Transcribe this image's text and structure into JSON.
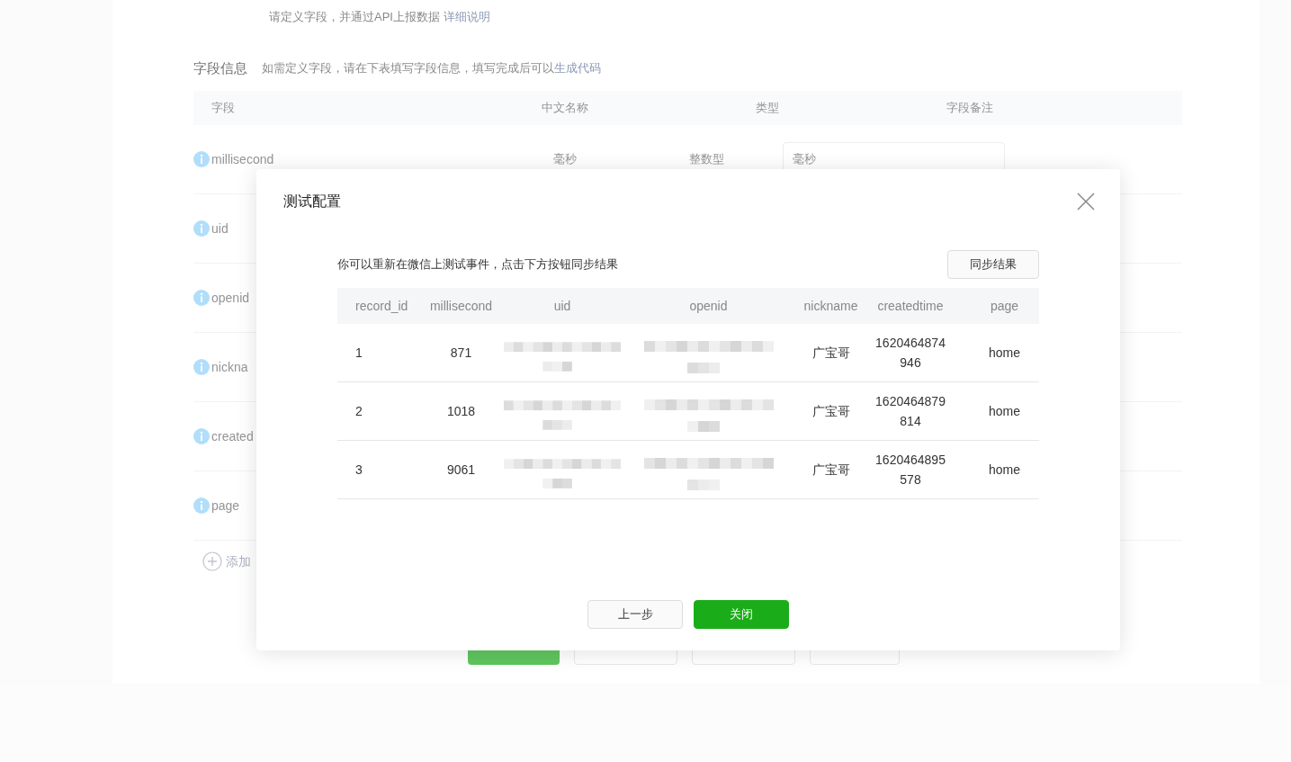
{
  "background": {
    "hint": "请定义字段，并通过API上报数据",
    "hint_link": "详细说明",
    "section_title": "字段信息",
    "section_desc": "如需定义字段，请在下表填写字段信息，填写完成后可以",
    "section_link": "生成代码",
    "columns": [
      "字段",
      "中文名称",
      "类型",
      "字段备注"
    ],
    "fields": [
      {
        "name": "millisecond",
        "cn_name": "毫秒",
        "type": "整数型",
        "remark": "毫秒"
      },
      {
        "name": "uid"
      },
      {
        "name": "openid"
      },
      {
        "name": "nickna"
      },
      {
        "name": "created"
      },
      {
        "name": "page"
      }
    ],
    "add_label": "添加"
  },
  "dialog": {
    "title": "测试配置",
    "description": "你可以重新在微信上测试事件，点击下方按钮同步结果",
    "sync_button": "同步结果",
    "columns": [
      {
        "label": "record_id",
        "kind": "text"
      },
      {
        "label": "millisecond",
        "kind": "text"
      },
      {
        "label": "uid",
        "kind": "redacted"
      },
      {
        "label": "openid",
        "kind": "redacted"
      },
      {
        "label": "nickname",
        "kind": "text"
      },
      {
        "label": "createdtime",
        "kind": "text"
      },
      {
        "label": "page",
        "kind": "text"
      }
    ],
    "rows": [
      {
        "record_id": "1",
        "millisecond": "871",
        "nickname": "广宝哥",
        "createdtime": "1620464874946",
        "page": "home"
      },
      {
        "record_id": "2",
        "millisecond": "1018",
        "nickname": "广宝哥",
        "createdtime": "1620464879814",
        "page": "home"
      },
      {
        "record_id": "3",
        "millisecond": "9061",
        "nickname": "广宝哥",
        "createdtime": "1620464895578",
        "page": "home"
      }
    ],
    "buttons": [
      {
        "label": "上一步",
        "kind": "secondary"
      },
      {
        "label": "关闭",
        "kind": "primary"
      }
    ]
  }
}
